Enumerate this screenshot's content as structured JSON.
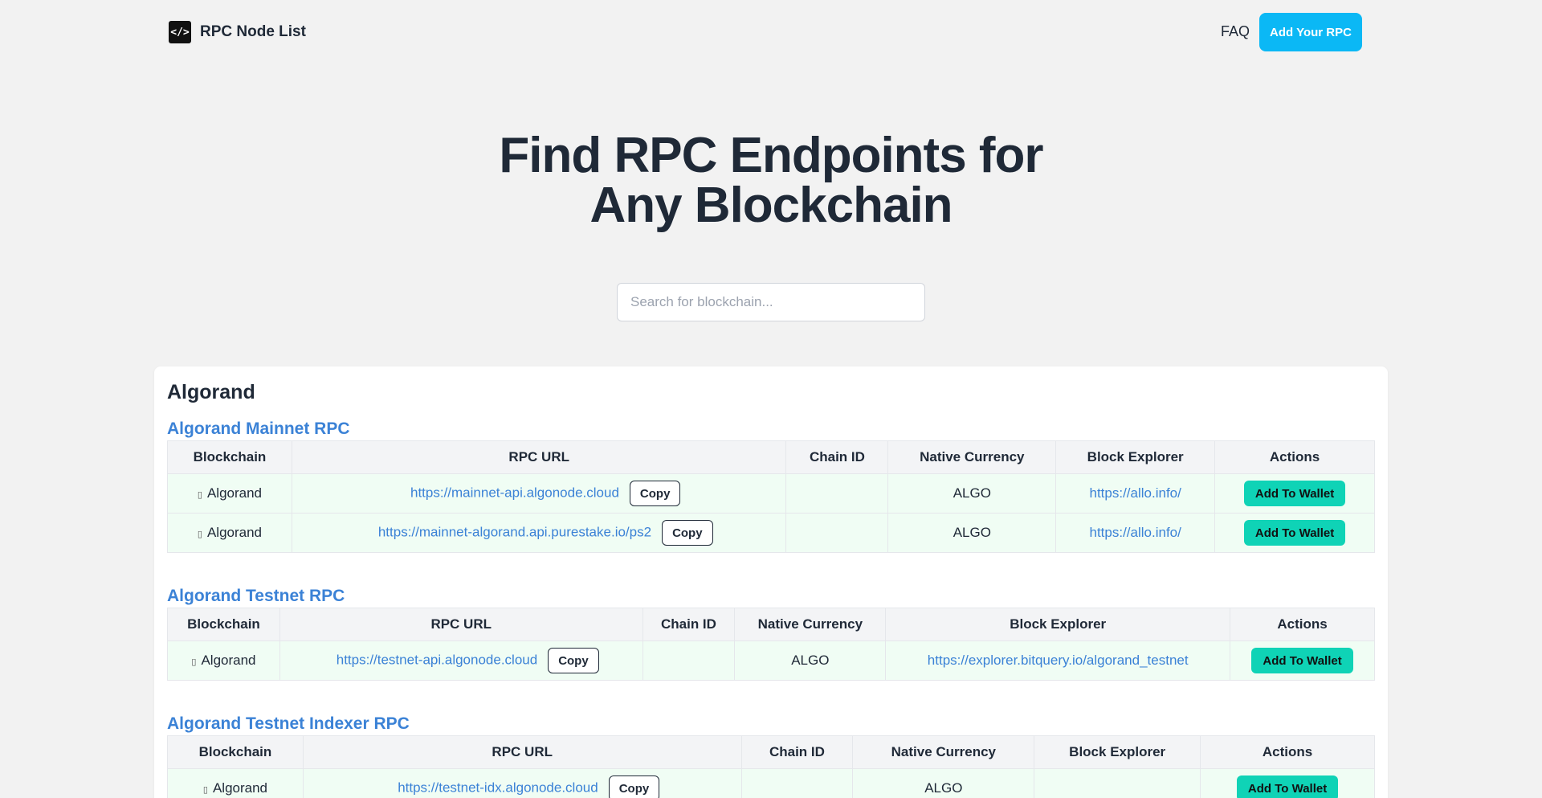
{
  "header": {
    "logo_glyph": "</>",
    "logo_text": "RPC Node List",
    "faq_label": "FAQ",
    "add_rpc_label": "Add Your RPC"
  },
  "hero": {
    "title_line1": "Find RPC Endpoints for",
    "title_line2": "Any Blockchain"
  },
  "search": {
    "placeholder": "Search for blockchain..."
  },
  "card": {
    "title": "Algorand",
    "chain_icon": "▯",
    "copy_label": "Copy",
    "wallet_label": "Add To Wallet",
    "columns": [
      "Blockchain",
      "RPC URL",
      "Chain ID",
      "Native Currency",
      "Block Explorer",
      "Actions"
    ],
    "networks": [
      {
        "title": "Algorand Mainnet RPC",
        "rows": [
          {
            "chain": "Algorand",
            "url": "https://mainnet-api.algonode.cloud",
            "chain_id": "",
            "currency": "ALGO",
            "explorer": "https://allo.info/"
          },
          {
            "chain": "Algorand",
            "url": "https://mainnet-algorand.api.purestake.io/ps2",
            "chain_id": "",
            "currency": "ALGO",
            "explorer": "https://allo.info/"
          }
        ]
      },
      {
        "title": "Algorand Testnet RPC",
        "rows": [
          {
            "chain": "Algorand",
            "url": "https://testnet-api.algonode.cloud",
            "chain_id": "",
            "currency": "ALGO",
            "explorer": "https://explorer.bitquery.io/algorand_testnet"
          }
        ]
      },
      {
        "title": "Algorand Testnet Indexer RPC",
        "rows": [
          {
            "chain": "Algorand",
            "url": "https://testnet-idx.algonode.cloud",
            "chain_id": "",
            "currency": "ALGO",
            "explorer": ""
          }
        ]
      }
    ]
  },
  "colors": {
    "background": "#f2f2f2",
    "accent_blue": "#0bb8f5",
    "link_blue": "#3b82d6",
    "wallet_teal": "#0fd3b6",
    "row_green": "#f0fdf4"
  }
}
